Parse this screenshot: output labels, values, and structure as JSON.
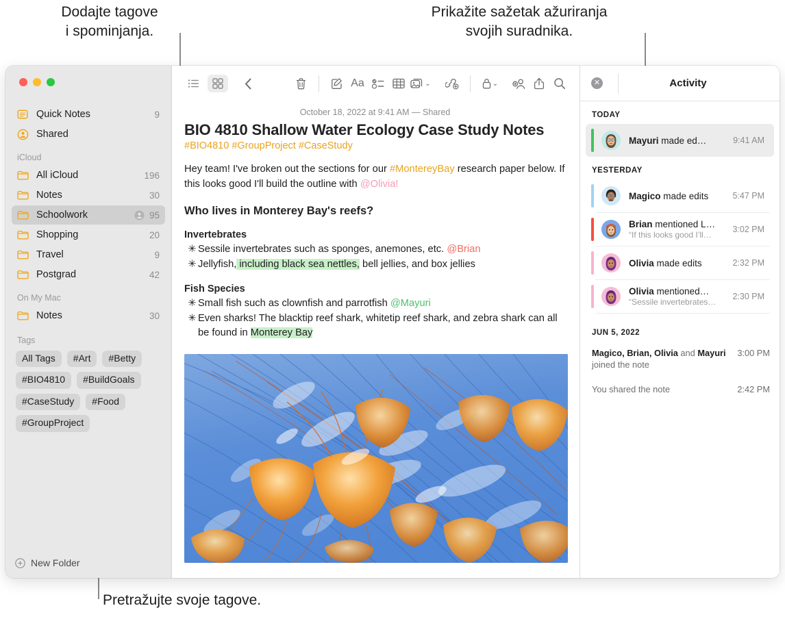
{
  "callouts": {
    "top_left": "Dodajte tagove\ni spominjanja.",
    "top_right": "Prikažite sažetak ažuriranja\nsvojih suradnika.",
    "bottom": "Pretražujte svoje tagove."
  },
  "window": {
    "traffic_lights": [
      "close-red",
      "minimize-yellow",
      "zoom-green"
    ]
  },
  "sidebar": {
    "top_items": [
      {
        "icon": "quick-notes-icon",
        "label": "Quick Notes",
        "count": "9"
      },
      {
        "icon": "shared-person-icon",
        "label": "Shared",
        "count": ""
      }
    ],
    "sections": [
      {
        "title": "iCloud",
        "items": [
          {
            "icon": "folder-icon",
            "label": "All iCloud",
            "count": "196",
            "selected": false,
            "shared": false
          },
          {
            "icon": "folder-icon",
            "label": "Notes",
            "count": "30",
            "selected": false,
            "shared": false
          },
          {
            "icon": "folder-icon",
            "label": "Schoolwork",
            "count": "95",
            "selected": true,
            "shared": true
          },
          {
            "icon": "folder-icon",
            "label": "Shopping",
            "count": "20",
            "selected": false,
            "shared": false
          },
          {
            "icon": "folder-icon",
            "label": "Travel",
            "count": "9",
            "selected": false,
            "shared": false
          },
          {
            "icon": "folder-icon",
            "label": "Postgrad",
            "count": "42",
            "selected": false,
            "shared": false
          }
        ]
      },
      {
        "title": "On My Mac",
        "items": [
          {
            "icon": "folder-icon",
            "label": "Notes",
            "count": "30",
            "selected": false,
            "shared": false
          }
        ]
      }
    ],
    "tags_section_title": "Tags",
    "tags": [
      "All Tags",
      "#Art",
      "#Betty",
      "#BIO4810",
      "#BuildGoals",
      "#CaseStudy",
      "#Food",
      "#GroupProject"
    ],
    "footer": {
      "icon": "plus-circle-icon",
      "label": "New Folder"
    }
  },
  "toolbar": {
    "left": [
      {
        "icon": "list-view-icon",
        "label": "",
        "active": false
      },
      {
        "icon": "gallery-view-icon",
        "label": "",
        "active": true
      },
      {
        "icon": "back-chevron-icon",
        "label": "",
        "active": false
      }
    ],
    "right": [
      {
        "icon": "trash-icon",
        "label": ""
      },
      {
        "icon": "compose-note-icon",
        "label": ""
      },
      {
        "icon": "format-aa-icon",
        "label": "Aa"
      },
      {
        "icon": "checklist-icon",
        "label": ""
      },
      {
        "icon": "table-icon",
        "label": ""
      },
      {
        "icon": "media-icon",
        "label": "",
        "chevron": "⌄"
      },
      {
        "icon": "add-link-icon",
        "label": ""
      },
      {
        "icon": "lock-icon",
        "label": "",
        "chevron": "⌄"
      },
      {
        "icon": "add-people-icon",
        "label": ""
      },
      {
        "icon": "share-icon",
        "label": ""
      },
      {
        "icon": "search-icon",
        "label": ""
      }
    ]
  },
  "note": {
    "date_line": "October 18, 2022 at 9:41 AM — Shared",
    "title": "BIO 4810 Shallow Water Ecology Case Study Notes",
    "tag_line": "#BIO4810 #GroupProject #CaseStudy",
    "intro": {
      "part1": "Hey team! I've broken out the sections for our ",
      "tag": "#MontereyBay",
      "part2": " research paper below. If this looks good I'll build the outline with ",
      "mention": "@Olivia!"
    },
    "heading": "Who lives in Monterey Bay's reefs?",
    "sections": [
      {
        "subheading": "Invertebrates",
        "bullets": [
          {
            "marker": "✳",
            "pre": "Sessile invertebrates such as sponges, anemones, etc. ",
            "mention": "@Brian",
            "mention_color": "red",
            "post": "",
            "highlight": "",
            "highlight_post": ""
          },
          {
            "marker": "✳",
            "pre": "Jellyfish,",
            "mention": "",
            "mention_color": "",
            "post": "",
            "highlight": " including black sea nettles,",
            "highlight_post": " bell jellies, and box jellies"
          }
        ]
      },
      {
        "subheading": "Fish Species",
        "bullets": [
          {
            "marker": "✳",
            "pre": "Small fish such as clownfish and parrotfish ",
            "mention": "@Mayuri",
            "mention_color": "green",
            "post": "",
            "highlight": "",
            "highlight_post": ""
          },
          {
            "marker": "✳",
            "pre": "Even sharks! The blacktip reef shark, whitetip reef shark, and zebra shark can all be found in ",
            "mention": "",
            "mention_color": "",
            "post": "",
            "highlight": "Monterey Bay",
            "highlight_post": ""
          }
        ]
      }
    ],
    "image_alt": "jellyfish-photo"
  },
  "activity": {
    "close_icon": "close-icon",
    "title": "Activity",
    "groups": [
      {
        "label": "TODAY",
        "items": [
          {
            "name": "Mayuri",
            "action": " made ed…",
            "quote": "",
            "time": "9:41 AM",
            "bar_color": "#3fc45e",
            "avatar_bg": "#bfe9ea",
            "selected": true
          }
        ]
      },
      {
        "label": "YESTERDAY",
        "items": [
          {
            "name": "Magico",
            "action": " made edits",
            "quote": "",
            "time": "5:47 PM",
            "bar_color": "#9fd3f5",
            "avatar_bg": "#cfe8f8",
            "selected": false
          },
          {
            "name": "Brian",
            "action": " mentioned L…",
            "quote": "“If this looks good I’ll…",
            "time": "3:02 PM",
            "bar_color": "#f4503c",
            "avatar_bg": "#7ba7e8",
            "selected": false
          },
          {
            "name": "Olivia",
            "action": " made edits",
            "quote": "",
            "time": "2:32 PM",
            "bar_color": "#f7b3cd",
            "avatar_bg": "#f4bcd6",
            "selected": false
          },
          {
            "name": "Olivia",
            "action": " mentioned…",
            "quote": "“Sessile invertebrates…",
            "time": "2:30 PM",
            "bar_color": "#f7b3cd",
            "avatar_bg": "#f4bcd6",
            "selected": false
          }
        ]
      }
    ],
    "history": {
      "label": "JUN 5, 2022",
      "rows": [
        {
          "names": "Magico, Brian, Olivia",
          "mid": " and ",
          "names2": "Mayuri",
          "tail": " joined the note",
          "time": "3:00 PM"
        },
        {
          "names": "",
          "mid": "",
          "names2": "",
          "tail": "You shared the note",
          "time": "2:42 PM"
        }
      ]
    }
  }
}
